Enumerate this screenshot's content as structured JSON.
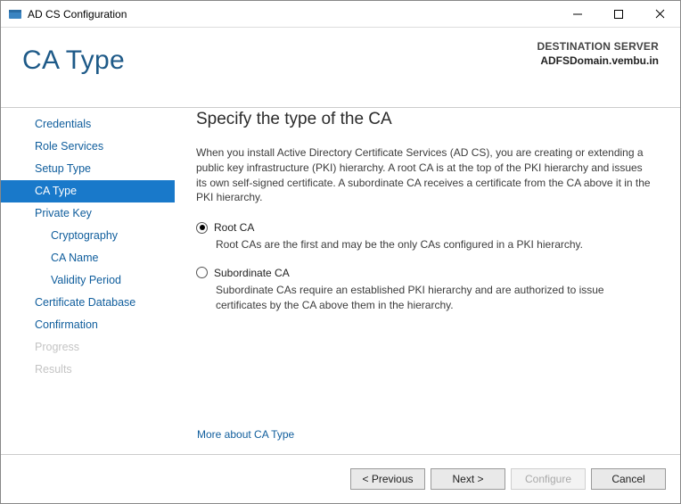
{
  "window": {
    "title": "AD CS Configuration"
  },
  "header": {
    "page_title": "CA Type",
    "destination_label": "DESTINATION SERVER",
    "destination_server": "ADFSDomain.vembu.in"
  },
  "sidebar": {
    "items": [
      {
        "label": "Credentials",
        "level": 1,
        "state": "normal"
      },
      {
        "label": "Role Services",
        "level": 1,
        "state": "normal"
      },
      {
        "label": "Setup Type",
        "level": 1,
        "state": "normal"
      },
      {
        "label": "CA Type",
        "level": 1,
        "state": "selected"
      },
      {
        "label": "Private Key",
        "level": 1,
        "state": "normal"
      },
      {
        "label": "Cryptography",
        "level": 2,
        "state": "normal"
      },
      {
        "label": "CA Name",
        "level": 2,
        "state": "normal"
      },
      {
        "label": "Validity Period",
        "level": 2,
        "state": "normal"
      },
      {
        "label": "Certificate Database",
        "level": 1,
        "state": "normal"
      },
      {
        "label": "Confirmation",
        "level": 1,
        "state": "normal"
      },
      {
        "label": "Progress",
        "level": 1,
        "state": "disabled"
      },
      {
        "label": "Results",
        "level": 1,
        "state": "disabled"
      }
    ]
  },
  "content": {
    "heading": "Specify the type of the CA",
    "description": "When you install Active Directory Certificate Services (AD CS), you are creating or extending a public key infrastructure (PKI) hierarchy. A root CA is at the top of the PKI hierarchy and issues its own self-signed certificate. A subordinate CA receives a certificate from the CA above it in the PKI hierarchy.",
    "options": [
      {
        "label": "Root CA",
        "selected": true,
        "description": "Root CAs are the first and may be the only CAs configured in a PKI hierarchy."
      },
      {
        "label": "Subordinate CA",
        "selected": false,
        "description": "Subordinate CAs require an established PKI hierarchy and are authorized to issue certificates by the CA above them in the hierarchy."
      }
    ],
    "more_link": "More about CA Type"
  },
  "footer": {
    "previous": "< Previous",
    "next": "Next >",
    "configure": "Configure",
    "cancel": "Cancel"
  }
}
